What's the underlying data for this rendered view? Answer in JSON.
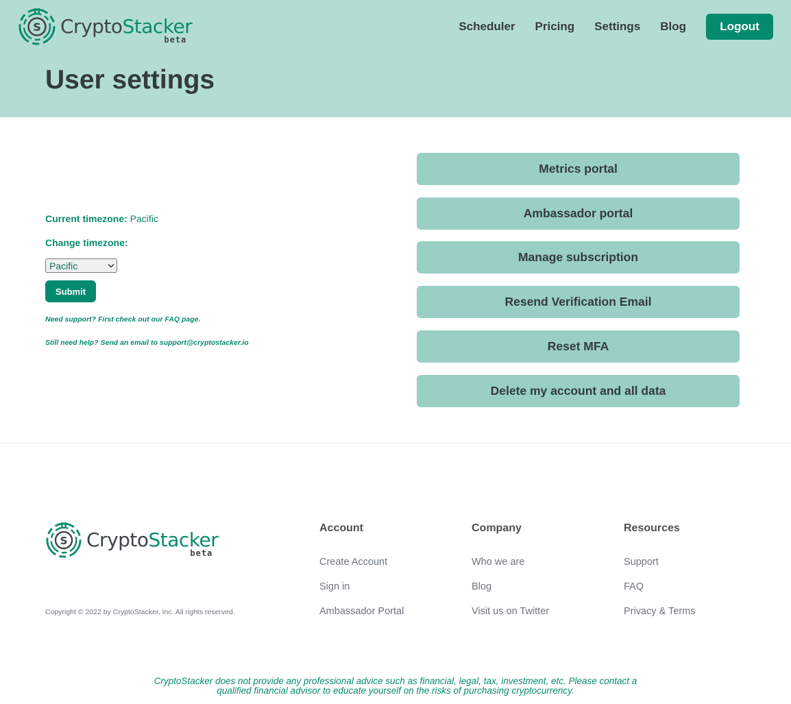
{
  "brand": {
    "name_part1": "Crypto",
    "name_part2": "Stacker",
    "tag": "beta",
    "primary_color": "#058a6e",
    "header_bg": "#b3ddd4",
    "button_bg": "#99cfc5"
  },
  "nav": {
    "items": [
      {
        "label": "Scheduler"
      },
      {
        "label": "Pricing"
      },
      {
        "label": "Settings"
      },
      {
        "label": "Blog"
      }
    ],
    "logout_label": "Logout"
  },
  "page": {
    "title": "User settings"
  },
  "timezone": {
    "current_label": "Current timezone:",
    "current_value": "Pacific",
    "change_label": "Change timezone:",
    "selected_option": "Pacific",
    "submit_label": "Submit"
  },
  "help": {
    "line1": "Need support? First check out our FAQ page.",
    "line2": "Still need help? Send an email to support@cryptostacker.io"
  },
  "actions": [
    {
      "label": "Metrics portal"
    },
    {
      "label": "Ambassador portal"
    },
    {
      "label": "Manage subscription"
    },
    {
      "label": "Resend Verification Email"
    },
    {
      "label": "Reset MFA"
    },
    {
      "label": "Delete my account and all data"
    }
  ],
  "footer": {
    "copyright": "Copyright © 2022 by CryptoStacker, Inc. All rights reserved.",
    "columns": [
      {
        "title": "Account",
        "links": [
          "Create Account",
          "Sign in",
          "Ambassador Portal"
        ]
      },
      {
        "title": "Company",
        "links": [
          "Who we are",
          "Blog",
          "Visit us on Twitter"
        ]
      },
      {
        "title": "Resources",
        "links": [
          "Support",
          "FAQ",
          "Privacy & Terms"
        ]
      }
    ],
    "disclaimer_line1": "CryptoStacker does not provide any professional advice such as financial, legal, tax, investment, etc. Please contact a",
    "disclaimer_line2": "qualified financial advisor to educate yourself on the risks of purchasing cryptocurrency."
  }
}
